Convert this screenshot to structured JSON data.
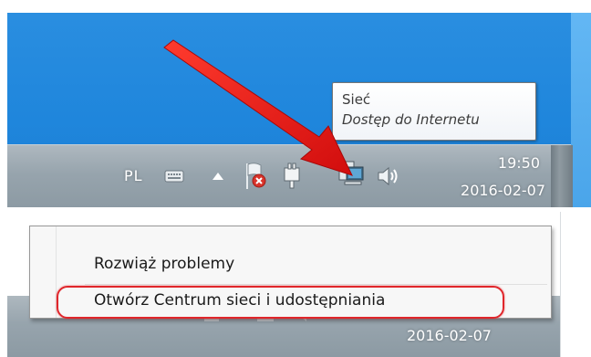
{
  "taskbar": {
    "language": "PL",
    "clock_time": "19:50",
    "clock_date": "2016-02-07",
    "icons": [
      "keyboard-icon",
      "show-hidden-icons-chevron",
      "action-center-flag-icon",
      "power-icon",
      "network-icon",
      "volume-icon"
    ]
  },
  "tooltip": {
    "title": "Sieć",
    "subtitle": "Dostęp do Internetu"
  },
  "context_menu": {
    "items": [
      {
        "label": "Rozwiąż problemy"
      },
      {
        "label": "Otwórz Centrum sieci i udostępniania"
      }
    ]
  },
  "bottom_taskbar": {
    "date": "2016-02-07"
  },
  "colors": {
    "desktop_blue": "#1f86dc",
    "taskbar_gray": "#97a4ad",
    "arrow_red": "#e01010",
    "highlight_red": "#e0262b"
  }
}
